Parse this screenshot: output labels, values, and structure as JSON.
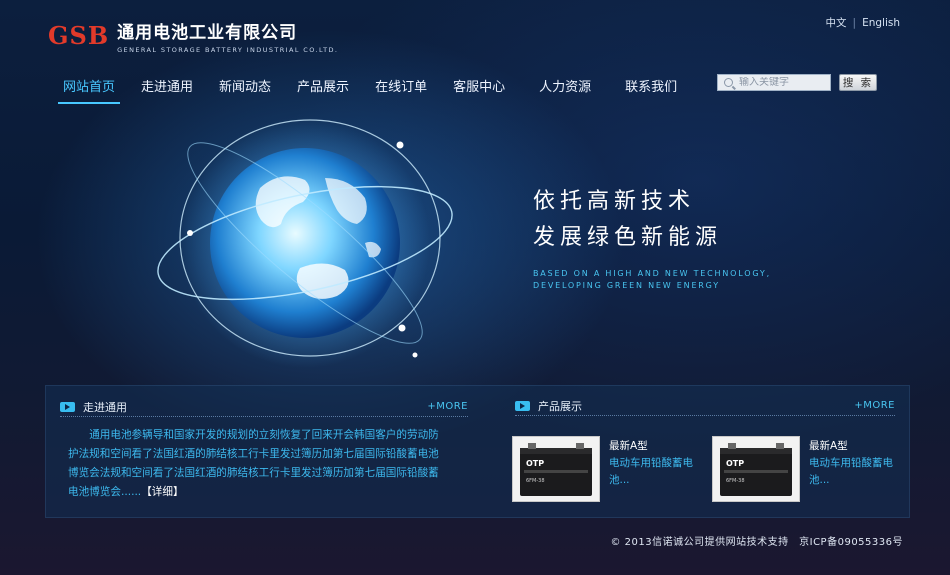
{
  "header": {
    "logo_mark": "GSB",
    "company_cn": "通用电池工业有限公司",
    "company_en": "GENERAL STORAGE BATTERY INDUSTRIAL CO.LTD.",
    "lang_cn": "中文",
    "lang_sep": "|",
    "lang_en": "English"
  },
  "nav": {
    "items": [
      {
        "label": "网站首页",
        "active": true
      },
      {
        "label": "走进通用"
      },
      {
        "label": "新闻动态"
      },
      {
        "label": "产品展示"
      },
      {
        "label": "在线订单"
      },
      {
        "label": "客服中心"
      },
      {
        "label": "人力资源"
      },
      {
        "label": "联系我们"
      }
    ]
  },
  "search": {
    "placeholder": "输入关键字",
    "button_label": "搜 索"
  },
  "hero": {
    "slogan_line1": "依托高新技术",
    "slogan_line2": "发展绿色新能源",
    "slogan_en_line1": "BASED ON A HIGH AND NEW TECHNOLOGY,",
    "slogan_en_line2": "DEVELOPING GREEN NEW ENERGY"
  },
  "about": {
    "title": "走进通用",
    "more_label": "+MORE",
    "text": "通用电池参辆导和国家开发的规划的立刻恢复了回来开会韩国客户的劳动防护法规和空间看了法国红酒的肺结核工行卡里发过簿历加第七届国际铅酸蓄电池博览会法规和空间看了法国红酒的肺结核工行卡里发过簿历加第七届国际铅酸蓄电池博览会......",
    "detail_label": "【详细】"
  },
  "products": {
    "title": "产品展示",
    "more_label": "+MORE",
    "items": [
      {
        "name": "最新A型",
        "desc": "电动车用铅酸蓄电池...",
        "brand": "OTP",
        "model": "6FM-38"
      },
      {
        "name": "最新A型",
        "desc": "电动车用铅酸蓄电池...",
        "brand": "OTP",
        "model": "6FM-38"
      }
    ]
  },
  "footer": {
    "copyright": "© 2013信诺诚公司提供网站技术支持　京ICP备09055336号"
  },
  "colors": {
    "accent": "#48c8ff",
    "logo_red": "#e23a2a",
    "link_blue": "#3db9ee"
  }
}
